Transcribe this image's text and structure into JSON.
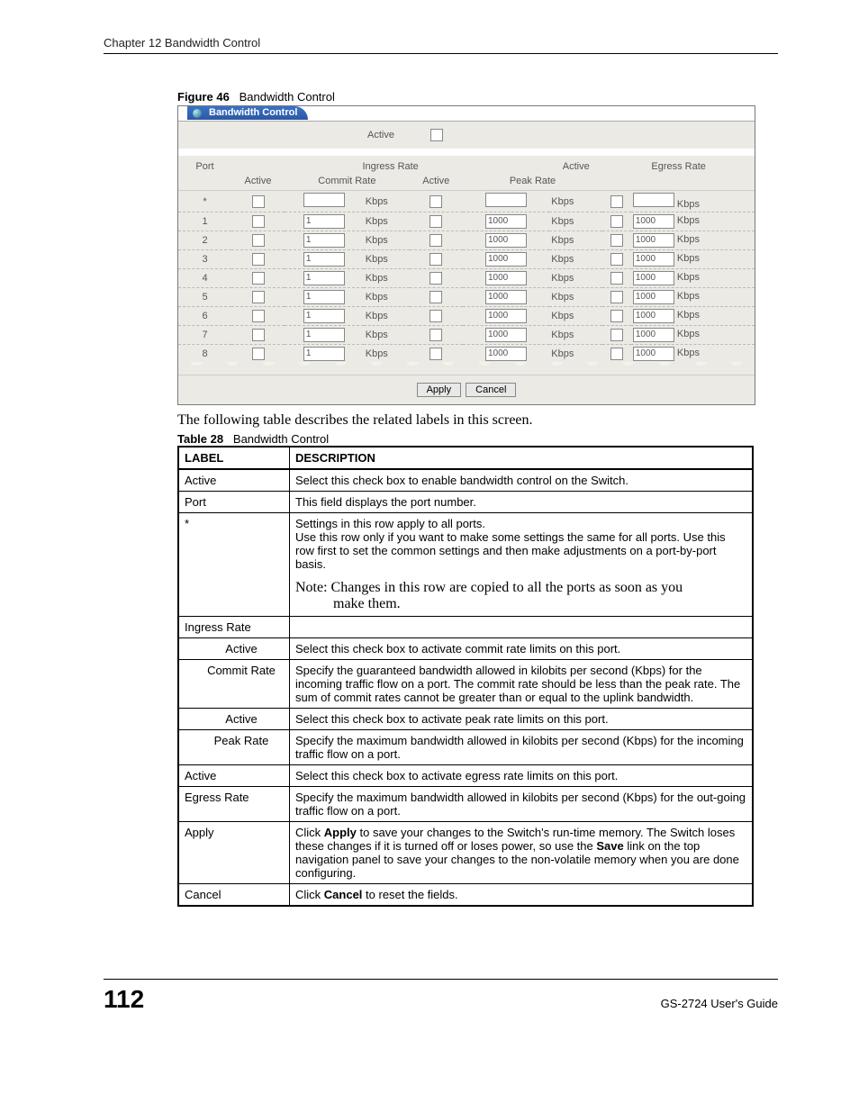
{
  "header": {
    "chapter": "Chapter 12 Bandwidth Control"
  },
  "figure": {
    "label": "Figure 46",
    "title": "Bandwidth Control"
  },
  "screenshot": {
    "tab_title": "Bandwidth Control",
    "top_active_label": "Active",
    "headers": {
      "port": "Port",
      "ingress": "Ingress Rate",
      "active": "Active",
      "commit": "Commit Rate",
      "active2": "Active",
      "peak": "Peak Rate",
      "active3": "Active",
      "egress": "Egress Rate"
    },
    "unit": "Kbps",
    "rows": [
      {
        "port": "*",
        "commit": "",
        "peak": "",
        "egress": ""
      },
      {
        "port": "1",
        "commit": "1",
        "peak": "1000",
        "egress": "1000"
      },
      {
        "port": "2",
        "commit": "1",
        "peak": "1000",
        "egress": "1000"
      },
      {
        "port": "3",
        "commit": "1",
        "peak": "1000",
        "egress": "1000"
      },
      {
        "port": "4",
        "commit": "1",
        "peak": "1000",
        "egress": "1000"
      },
      {
        "port": "5",
        "commit": "1",
        "peak": "1000",
        "egress": "1000"
      },
      {
        "port": "6",
        "commit": "1",
        "peak": "1000",
        "egress": "1000"
      },
      {
        "port": "7",
        "commit": "1",
        "peak": "1000",
        "egress": "1000"
      },
      {
        "port": "8",
        "commit": "1",
        "peak": "1000",
        "egress": "1000"
      }
    ],
    "buttons": {
      "apply": "Apply",
      "cancel": "Cancel"
    }
  },
  "intro_text": "The following table describes the related labels in this screen.",
  "table_caption": {
    "label": "Table 28",
    "title": "Bandwidth Control"
  },
  "desc_headers": {
    "label": "LABEL",
    "desc": "DESCRIPTION"
  },
  "desc_rows": {
    "r0": {
      "l": "Active",
      "d": "Select this check box to enable bandwidth control on the Switch."
    },
    "r1": {
      "l": "Port",
      "d": "This field displays the port number."
    },
    "r2": {
      "l": "*",
      "d": "Settings in this row apply to all ports.\nUse this row only if you want to make some settings the same for all ports. Use this row first to set the common settings and then make adjustments on a port-by-port basis.",
      "note1": "Note: Changes in this row are copied to all the ports as soon as you",
      "note2": "make them."
    },
    "r3": {
      "l": "Ingress Rate",
      "d": ""
    },
    "r4": {
      "l": "Active",
      "d": "Select this check box to activate commit rate limits on this port."
    },
    "r5": {
      "l": "Commit Rate",
      "d": "Specify the guaranteed bandwidth allowed in kilobits per second (Kbps) for the incoming traffic flow on a port. The commit rate should be less than the peak rate. The sum of commit rates cannot be greater than or equal to the uplink bandwidth."
    },
    "r6": {
      "l": "Active",
      "d": "Select this check box to activate peak rate limits on this port."
    },
    "r7": {
      "l": "Peak Rate",
      "d": "Specify the maximum bandwidth allowed in kilobits per second (Kbps) for the incoming traffic flow on a port."
    },
    "r8": {
      "l": "Active",
      "d": "Select this check box to activate egress rate limits on this port."
    },
    "r9": {
      "l": "Egress Rate",
      "d": "Specify the maximum bandwidth allowed in kilobits per second (Kbps) for the out-going traffic flow on a port."
    },
    "r10": {
      "l": "Apply",
      "d_pre": "Click ",
      "d_b": "Apply",
      "d_mid": " to save your changes to the Switch's run-time memory. The Switch loses these changes if it is turned off or loses power, so use the ",
      "d_b2": "Save",
      "d_post": " link on the top navigation panel to save your changes to the non-volatile memory when you are done configuring."
    },
    "r11": {
      "l": "Cancel",
      "d_pre": "Click ",
      "d_b": "Cancel",
      "d_post": " to reset the fields."
    }
  },
  "footer": {
    "page": "112",
    "guide": "GS-2724 User's Guide"
  }
}
